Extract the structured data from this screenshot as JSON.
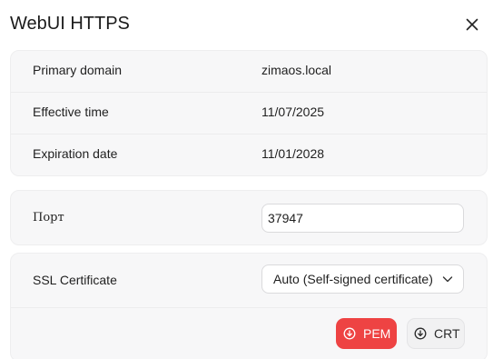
{
  "dialog": {
    "title": "WebUI HTTPS"
  },
  "info": {
    "rows": [
      {
        "label": "Primary domain",
        "value": "zimaos.local"
      },
      {
        "label": "Effective time",
        "value": "11/07/2025"
      },
      {
        "label": "Expiration date",
        "value": "11/01/2028"
      }
    ]
  },
  "port": {
    "label": "Порт",
    "value": "37947"
  },
  "ssl": {
    "label": "SSL Certificate",
    "selected": "Auto (Self-signed certificate)",
    "pem_label": "PEM",
    "crt_label": "CRT"
  },
  "colors": {
    "accent_red": "#ee4343",
    "card_bg": "#f7f7f8"
  },
  "icons": [
    "close-icon",
    "chevron-down-icon",
    "download-icon"
  ]
}
